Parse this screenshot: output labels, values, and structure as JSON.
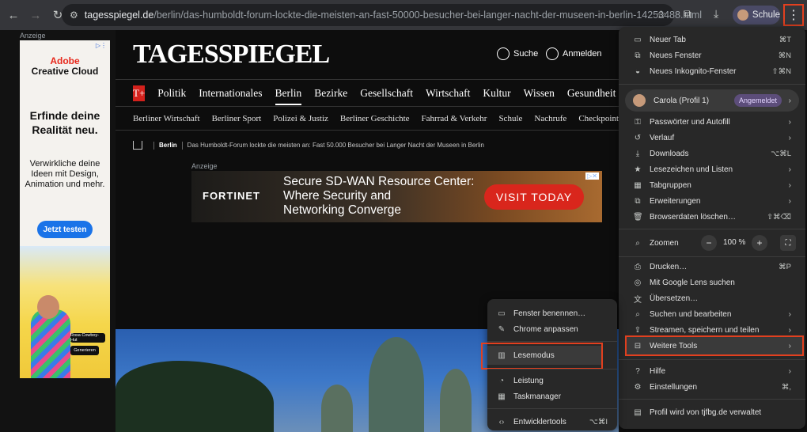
{
  "browser": {
    "url_domain": "tagesspiegel.de",
    "url_path": "/berlin/das-humboldt-forum-lockte-die-meisten-an-fast-50000-besucher-bei-langer-nacht-der-museen-in-berlin-14253488.html",
    "profile_label": "Schule"
  },
  "left_ad": {
    "label": "Anzeige",
    "logo_line1": "Adobe",
    "logo_line2": "Creative Cloud",
    "headline": "Erfinde deine Realität neu.",
    "body": "Verwirkliche deine Ideen mit Design, Animation und mehr.",
    "cta": "Jetzt testen",
    "chip1": "Rosa Cowboy-Hut",
    "chip2": "Generieren"
  },
  "site": {
    "logo": "TAGESSPIEGEL",
    "search_label": "Suche",
    "login_label": "Anmelden",
    "tplus": "T+",
    "nav_primary": [
      "Politik",
      "Internationales",
      "Berlin",
      "Bezirke",
      "Gesellschaft",
      "Wirtschaft",
      "Kultur",
      "Wissen",
      "Gesundheit"
    ],
    "nav_secondary": [
      "Berliner Wirtschaft",
      "Berliner Sport",
      "Polizei & Justiz",
      "Berliner Geschichte",
      "Fahrrad & Verkehr",
      "Schule",
      "Nachrufe",
      "Checkpoint"
    ],
    "breadcrumb_section": "Berlin",
    "breadcrumb_title": "Das Humboldt-Forum lockte die meisten an: Fast 50.000 Besucher bei Langer Nacht der Museen in Berlin",
    "mid_ad_label": "Anzeige",
    "mid_ad_brand": "FORTINET",
    "mid_ad_text_1": "Secure SD-WAN Resource Center:",
    "mid_ad_text_2": "Where Security and",
    "mid_ad_text_3": "Networking Converge",
    "mid_ad_cta": "VISIT TODAY"
  },
  "menu": {
    "new_tab": "Neuer Tab",
    "new_tab_sc": "⌘T",
    "new_window": "Neues Fenster",
    "new_window_sc": "⌘N",
    "incognito": "Neues Inkognito-Fenster",
    "incognito_sc": "⇧⌘N",
    "profile_name": "Carola (Profil 1)",
    "profile_status": "Angemeldet",
    "passwords": "Passwörter und Autofill",
    "history": "Verlauf",
    "downloads": "Downloads",
    "downloads_sc": "⌥⌘L",
    "bookmarks": "Lesezeichen und Listen",
    "tab_groups": "Tabgruppen",
    "extensions": "Erweiterungen",
    "clear_data": "Browserdaten löschen…",
    "clear_data_sc": "⇧⌘⌫",
    "zoom_label": "Zoomen",
    "zoom_minus": "−",
    "zoom_value": "100 %",
    "zoom_plus": "+",
    "print": "Drucken…",
    "print_sc": "⌘P",
    "lens": "Mit Google Lens suchen",
    "translate": "Übersetzen…",
    "find_edit": "Suchen und bearbeiten",
    "cast_save": "Streamen, speichern und teilen",
    "more_tools": "Weitere Tools",
    "help": "Hilfe",
    "settings": "Einstellungen",
    "settings_sc": "⌘,",
    "managed": "Profil wird von tjfbg.de verwaltet"
  },
  "submenu": {
    "name_window": "Fenster benennen…",
    "customize": "Chrome anpassen",
    "reading_mode": "Lesemodus",
    "performance": "Leistung",
    "task_manager": "Taskmanager",
    "devtools": "Entwicklertools",
    "devtools_sc": "⌥⌘I"
  }
}
